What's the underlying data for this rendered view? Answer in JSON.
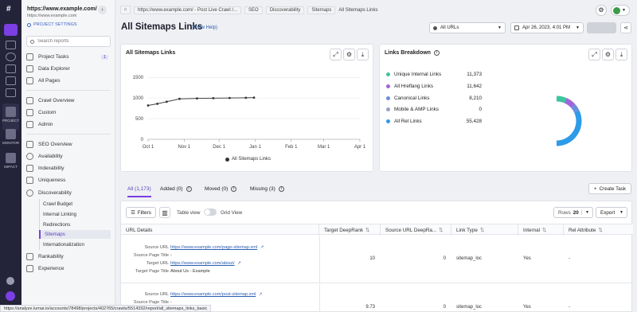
{
  "project": {
    "name": "https://www.example.com/",
    "url": "https://www.example.com",
    "settings_label": "PROJECT SETTINGS"
  },
  "search": {
    "placeholder": "Search reports"
  },
  "sidebar": {
    "items": [
      {
        "label": "Project Tasks",
        "badge": "1"
      },
      {
        "label": "Data Explorer"
      },
      {
        "label": "All Pages"
      },
      {
        "label": "Crawl Overview"
      },
      {
        "label": "Custom"
      },
      {
        "label": "Admin"
      },
      {
        "label": "SEO Overview"
      },
      {
        "label": "Availability"
      },
      {
        "label": "Indexability"
      },
      {
        "label": "Uniqueness"
      },
      {
        "label": "Discoverability"
      },
      {
        "label": "Rankability"
      },
      {
        "label": "Experience"
      }
    ],
    "discoverability_children": [
      "Crawl Budget",
      "Internal Linking",
      "Redirections",
      "Sitemaps",
      "Internationalization"
    ]
  },
  "rail": {
    "project": "PROJECT",
    "monitor": "MONITOR",
    "impact": "IMPACT"
  },
  "breadcrumbs": [
    "https://www.example.com/ - Post Live Crawl /...",
    "SEO",
    "Discoverability",
    "Sitemaps",
    "All Sitemaps Links"
  ],
  "header": {
    "title": "All Sitemaps Links",
    "help": "(Show Help)",
    "url_filter": "All URLs",
    "date": "Apr 26, 2023, 4:01 PM"
  },
  "chart_card": {
    "title": "All Sitemaps Links",
    "legend": "All Sitemaps Links"
  },
  "chart_data": {
    "type": "line",
    "title": "All Sitemaps Links",
    "x": [
      "Oct 1",
      "Nov 1",
      "Dec 1",
      "Jan 1",
      "Feb 1",
      "Mar 1",
      "Apr 1"
    ],
    "yticks": [
      0,
      500,
      1000,
      1500
    ],
    "ylim": [
      0,
      1600
    ],
    "series": [
      {
        "name": "All Sitemaps Links",
        "points": [
          {
            "x": "2022-10-01",
            "y": 820
          },
          {
            "x": "2022-10-09",
            "y": 860
          },
          {
            "x": "2022-10-17",
            "y": 910
          },
          {
            "x": "2022-10-28",
            "y": 980
          },
          {
            "x": "2022-11-12",
            "y": 990
          },
          {
            "x": "2022-11-26",
            "y": 995
          },
          {
            "x": "2022-12-10",
            "y": 1000
          },
          {
            "x": "2022-12-24",
            "y": 1005
          },
          {
            "x": "2022-12-31",
            "y": 1010
          }
        ]
      }
    ],
    "xlabel": "",
    "ylabel": "",
    "grid": true,
    "legend": "bottom"
  },
  "breakdown": {
    "title": "Links Breakdown",
    "rows": [
      {
        "label": "Unique Internal Links",
        "value": "11,373",
        "color": "#3cc6a0"
      },
      {
        "label": "All Hreflang Links",
        "value": "11,642",
        "color": "#a066d8"
      },
      {
        "label": "Canonical Links",
        "value": "8,210",
        "color": "#6b8fe0"
      },
      {
        "label": "Mobile & AMP Links",
        "value": "0",
        "color": "#9aa0c8"
      },
      {
        "label": "All Rel Links",
        "value": "55,428",
        "color": "#2e9be8"
      }
    ]
  },
  "tabs": [
    {
      "label": "All (1,173)"
    },
    {
      "label": "Added (0)"
    },
    {
      "label": "Moved (0)"
    },
    {
      "label": "Missing (3)"
    }
  ],
  "toolbar": {
    "create_task": "Create Task",
    "filters": "Filters",
    "table_view": "Table view",
    "grid_view": "Grid View",
    "rows_label": "Rows",
    "rows_value": "20",
    "export": "Export"
  },
  "table": {
    "headers": [
      "URL Details",
      "Target DeepRank",
      "Source URL DeepRa...",
      "Link Type",
      "Internal",
      "Rel Attribute"
    ],
    "detail_labels": [
      "Source URL",
      "Source Page Title",
      "Target URL",
      "Target Page Title"
    ],
    "rows": [
      {
        "source_url": "https://www.example.com/page-sitemap.xml",
        "source_title": "-",
        "target_url": "https://www.example.com/about/",
        "target_title": "About Us - Example",
        "target_deeprank": "10",
        "source_deeprank": "0",
        "link_type": "sitemap_loc",
        "internal": "Yes",
        "rel": "-"
      },
      {
        "source_url": "https://www.example.com/post-sitemap.xml",
        "source_title": "-",
        "target_url": "...",
        "target_title": "",
        "target_deeprank": "9.73",
        "source_deeprank": "0",
        "link_type": "sitemap_loc",
        "internal": "Yes",
        "rel": "-"
      }
    ]
  },
  "status_bar": "https://analyze.lumar.io/accounts/78498/projects/402765/crawls/5514332/report/all_sitemaps_links_basic"
}
